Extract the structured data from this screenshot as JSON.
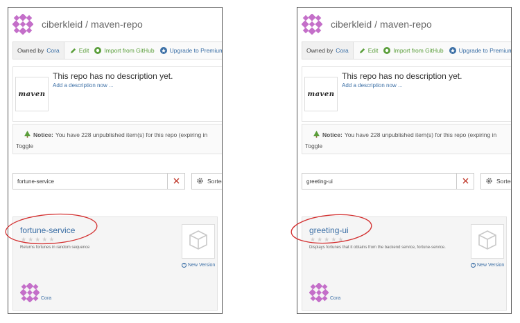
{
  "colors": {
    "accent": "#3a6ea5",
    "success": "#5a9e3a",
    "annotation": "#d32f2f",
    "logo": "#c46fc9"
  },
  "panels": [
    {
      "owner": "ciberkleid",
      "repo": "maven-repo",
      "toolbar": {
        "owned_by": "Owned by",
        "owner_name": "Cora",
        "edit": "Edit",
        "import": "Import from GitHub",
        "premium": "Upgrade to Premium"
      },
      "description": {
        "logo_text": "maven",
        "title": "This repo has no description yet.",
        "link": "Add a description now ..."
      },
      "notice": {
        "label": "Notice:",
        "text": "You have 228 unpublished item(s) for this repo (expiring in",
        "toggle": "Toggle"
      },
      "search": {
        "value": "fortune-service",
        "sort": "Sorted"
      },
      "card": {
        "title": "fortune-service",
        "description": "Returns fortunes in random sequence",
        "new_version": "New Version",
        "owner": "Cora",
        "rating": 0
      }
    },
    {
      "owner": "ciberkleid",
      "repo": "maven-repo",
      "toolbar": {
        "owned_by": "Owned by",
        "owner_name": "Cora",
        "edit": "Edit",
        "import": "Import from GitHub",
        "premium": "Upgrade to Premium"
      },
      "description": {
        "logo_text": "maven",
        "title": "This repo has no description yet.",
        "link": "Add a description now ..."
      },
      "notice": {
        "label": "Notice:",
        "text": "You have 228 unpublished item(s) for this repo (expiring in",
        "toggle": "Toggle"
      },
      "search": {
        "value": "greeting-ui",
        "sort": "Sorted"
      },
      "card": {
        "title": "greeting-ui",
        "description": "Displays fortunes that it obtains from the backend service, fortune-service.",
        "new_version": "New Version",
        "owner": "Cora",
        "rating": 0
      }
    }
  ]
}
